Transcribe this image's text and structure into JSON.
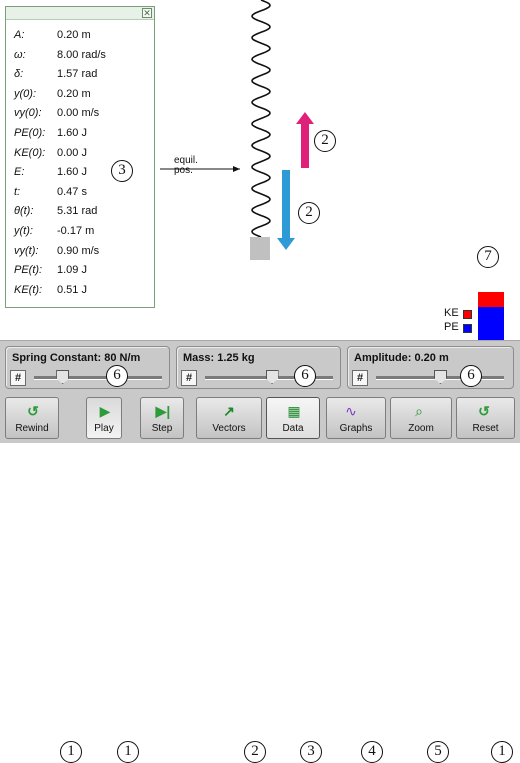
{
  "data_panel": {
    "rows": [
      {
        "label": "A:",
        "value": "0.20 m"
      },
      {
        "label": "ω:",
        "value": "8.00 rad/s"
      },
      {
        "label": "δ:",
        "value": "1.57 rad"
      },
      {
        "label": "y(0):",
        "value": "0.20 m"
      },
      {
        "label": "vy(0):",
        "value": "0.00 m/s"
      },
      {
        "label": "PE(0):",
        "value": "1.60 J"
      },
      {
        "label": "KE(0):",
        "value": "0.00 J"
      },
      {
        "label": "E:",
        "value": "1.60 J"
      },
      {
        "label": "t:",
        "value": "0.47 s"
      },
      {
        "label": "θ(t):",
        "value": "5.31 rad"
      },
      {
        "label": "y(t):",
        "value": "-0.17 m"
      },
      {
        "label": "vy(t):",
        "value": "0.90 m/s"
      },
      {
        "label": "PE(t):",
        "value": "1.09 J"
      },
      {
        "label": "KE(t):",
        "value": "0.51 J"
      }
    ],
    "close_glyph": "✕"
  },
  "annotations": {
    "panel_marker": "3",
    "velocity_marker": "2",
    "force_marker": "2",
    "energy_marker": "7",
    "equilibrium_label_line1": "equil.",
    "equilibrium_label_line2": "pos."
  },
  "energy": {
    "ke_label": "KE",
    "pe_label": "PE",
    "ke_value_J": 0.51,
    "pe_value_J": 1.09,
    "ke_color": "#ff0000",
    "pe_color": "#0000ff"
  },
  "sliders": [
    {
      "label": "Spring Constant: 80 N/m",
      "marker": "6",
      "fraction": 0.22
    },
    {
      "label": "Mass: 1.25 kg",
      "marker": "6",
      "fraction": 0.52
    },
    {
      "label": "Amplitude: 0.20 m",
      "marker": "6",
      "fraction": 0.5
    }
  ],
  "slider_hash": "#",
  "toolbar": {
    "rewind": {
      "label": "Rewind",
      "marker": "1",
      "icon": "rewind-icon"
    },
    "play": {
      "label": "Play",
      "marker": "1",
      "icon": "play-icon"
    },
    "step": {
      "label": "Step",
      "marker": "1",
      "icon": "step-icon"
    },
    "vectors": {
      "label": "Vectors",
      "marker": "2",
      "icon": "vectors-arrow-icon"
    },
    "data": {
      "label": "Data",
      "marker": "3",
      "icon": "data-table-icon"
    },
    "graphs": {
      "label": "Graphs",
      "marker": "4",
      "icon": "graphs-icon"
    },
    "zoom": {
      "label": "Zoom",
      "marker": "5",
      "icon": "zoom-icon"
    },
    "reset": {
      "label": "Reset",
      "marker": "1",
      "icon": "reset-icon"
    }
  },
  "colors": {
    "velocity_arrow": "#e0217a",
    "force_arrow": "#2e9bd6",
    "mass_block": "#c0c0c0",
    "controls_bg": "#c9c9c9"
  }
}
